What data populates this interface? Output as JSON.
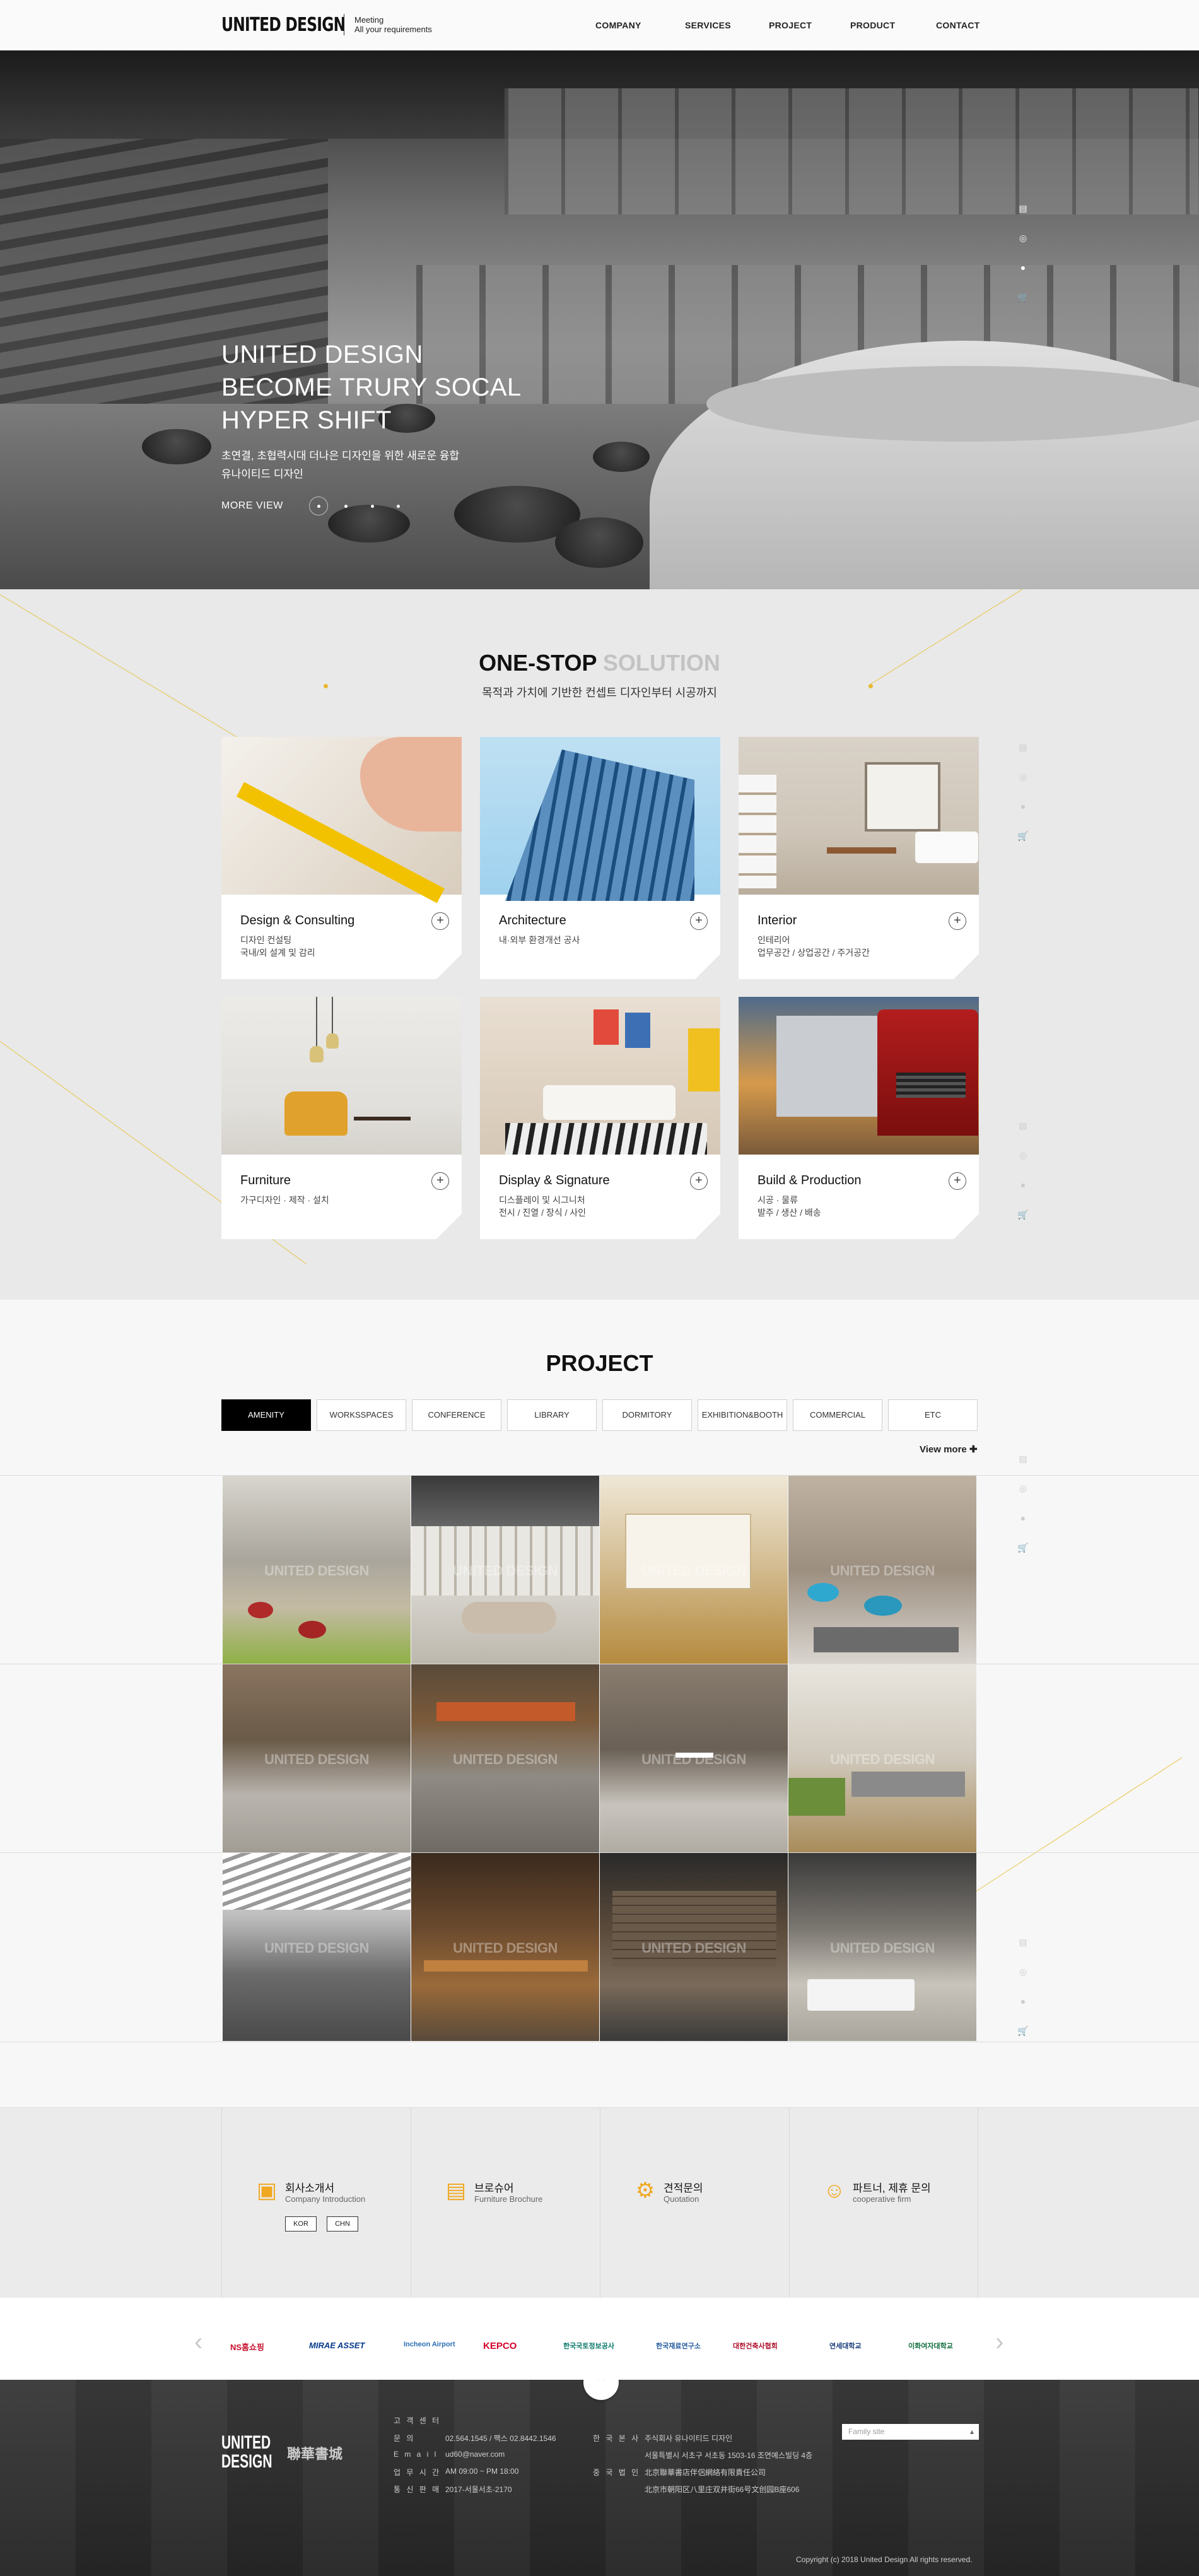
{
  "header": {
    "logo": "UNITED DESIGN",
    "tagline_line1": "Meeting",
    "tagline_line2": "All your requirements",
    "nav": [
      "COMPANY",
      "SERVICES",
      "PROJECT",
      "PRODUCT",
      "CONTACT"
    ]
  },
  "hero": {
    "title_line1": "UNITED DESIGN",
    "title_line2": "BECOME TRURY SOCAL",
    "title_line3": "HYPER SHIFT",
    "sub_line1": "초연결, 초협력시대 더나은 디자인을 위한 새로운 융합",
    "sub_line2": "유나이티드 디자인",
    "more_view": "MORE VIEW"
  },
  "side_icons": [
    "blog-icon",
    "instagram-icon",
    "chat-icon",
    "cart-icon"
  ],
  "solution": {
    "title_main": "ONE-STOP",
    "title_gray": "SOLUTION",
    "subtitle": "목적과 가치에 기반한 컨셉트 디자인부터 시공까지",
    "cards": [
      {
        "title": "Design & Consulting",
        "desc1": "디자인 컨설팅",
        "desc2": "국내/외 설계 및 감리"
      },
      {
        "title": "Architecture",
        "desc1": "내·외부 환경개선 공사",
        "desc2": ""
      },
      {
        "title": "Interior",
        "desc1": "인테리어",
        "desc2": "업무공간 / 상업공간 / 주거공간"
      },
      {
        "title": "Furniture",
        "desc1": "가구디자인 · 제작 · 설치",
        "desc2": ""
      },
      {
        "title": "Display & Signature",
        "desc1": "디스플레이 및 시그니처",
        "desc2": "전시 / 진열 / 장식 / 사인"
      },
      {
        "title": "Build & Production",
        "desc1": "시공 · 물류",
        "desc2": "발주 / 생산 / 배송"
      }
    ]
  },
  "project": {
    "title": "PROJECT",
    "tabs": [
      "AMENITY",
      "WORKSSPACES",
      "CONFERENCE",
      "LIBRARY",
      "DORMITORY",
      "EXHIBITION&BOOTH",
      "COMMERCIAL",
      "ETC"
    ],
    "view_more": "View more",
    "watermark": "UNITED DESIGN"
  },
  "info": [
    {
      "title": "회사소개서",
      "sub": "Company Introduction",
      "icon": "presentation-icon"
    },
    {
      "title": "브로슈어",
      "sub": "Furniture Brochure",
      "icon": "brochure-icon"
    },
    {
      "title": "견적문의",
      "sub": "Quotation",
      "icon": "person-gear-icon"
    },
    {
      "title": "파트너, 제휴 문의",
      "sub": "cooperative firm",
      "icon": "group-icon"
    }
  ],
  "lang_buttons": [
    "KOR",
    "CHN"
  ],
  "partners": [
    "NS홈쇼핑",
    "MIRAE ASSET",
    "Incheon Airport",
    "KEPCO",
    "한국국토정보공사",
    "한국재료연구소",
    "대한건축사협회",
    "연세대학교",
    "이화여자대학교"
  ],
  "footer": {
    "logo_line1": "UNITED",
    "logo_line2": "DESIGN",
    "logo2": "聯華書城",
    "center_label": "고 객 센 터",
    "rows_left": [
      {
        "label": "문 의",
        "value": "02.564.1545 / 팩스 02.8442.1546"
      },
      {
        "label": "E m a i l",
        "value": "ud60@naver.com"
      },
      {
        "label": "업 무 시 간",
        "value": "AM 09:00 ~ PM 18:00"
      },
      {
        "label": "통 신 판 매",
        "value": "2017-서울서초-2170"
      }
    ],
    "rows_right": [
      {
        "label": "한 국 본 사",
        "value": "주식회사 유나이티드 디자인"
      },
      {
        "label": "",
        "value": "서울특별시 서초구 서초동 1503-16 조연예스빌딩 4층"
      },
      {
        "label": "중 국 법 인",
        "value": "北京聯華書店伴侶網絡有限責任公司"
      },
      {
        "label": "",
        "value": "北京市朝阳区八里庄双井街66号文创园B座606"
      }
    ],
    "family_site": "Family site",
    "copyright": "Copyright (c) 2018 United Design All rights reserved."
  },
  "colors": {
    "accent": "#f0a820",
    "dark": "#000000",
    "line": "#e8c547"
  }
}
